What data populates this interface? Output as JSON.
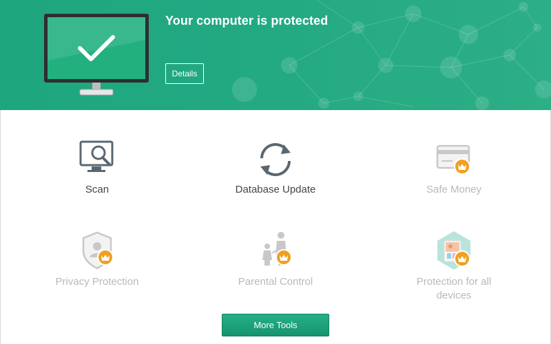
{
  "banner": {
    "status_title": "Your computer is protected",
    "details_label": "Details",
    "colors": {
      "accent": "#22a982",
      "text": "#ffffff"
    }
  },
  "tiles": [
    {
      "label": "Scan",
      "icon": "scan-icon",
      "premium": false
    },
    {
      "label": "Database Update",
      "icon": "update-icon",
      "premium": false
    },
    {
      "label": "Safe Money",
      "icon": "safe-money-icon",
      "premium": true
    },
    {
      "label": "Privacy Protection",
      "icon": "privacy-icon",
      "premium": true
    },
    {
      "label": "Parental Control",
      "icon": "parental-control-icon",
      "premium": true
    },
    {
      "label": "Protection for all devices",
      "icon": "devices-icon",
      "premium": true
    }
  ],
  "footer": {
    "more_tools_label": "More Tools"
  },
  "colors": {
    "premium_badge": "#f0a020",
    "disabled_text": "#b9b9b9",
    "active_text": "#444444"
  }
}
